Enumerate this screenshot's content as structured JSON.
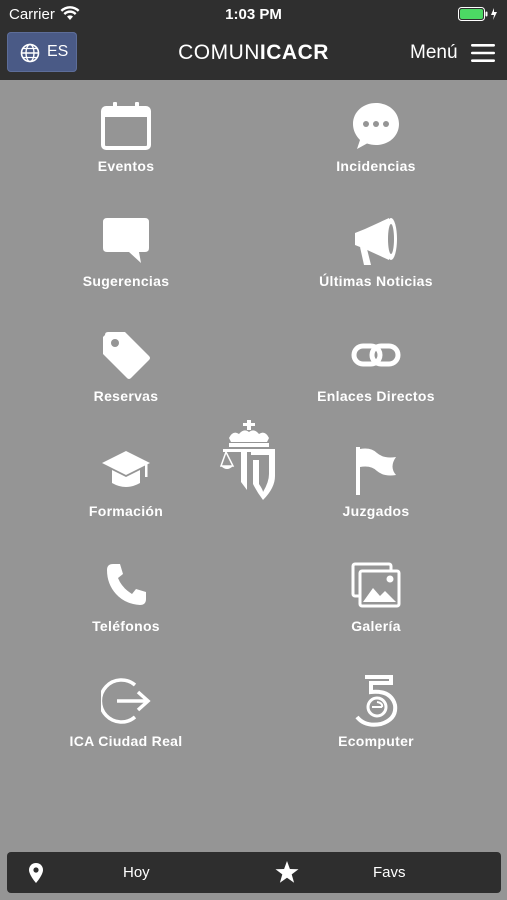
{
  "status_bar": {
    "carrier": "Carrier",
    "time": "1:03 PM"
  },
  "nav": {
    "language": "ES",
    "title_light": "COMUN",
    "title_bold": "ICACR",
    "menu_label": "Menú"
  },
  "tiles": [
    {
      "label": "Eventos",
      "icon": "calendar-icon"
    },
    {
      "label": "Incidencias",
      "icon": "chat-bubble-icon"
    },
    {
      "label": "Sugerencias",
      "icon": "message-icon"
    },
    {
      "label": "Últimas Noticias",
      "icon": "megaphone-icon"
    },
    {
      "label": "Reservas",
      "icon": "tag-icon"
    },
    {
      "label": "Enlaces Directos",
      "icon": "link-icon"
    },
    {
      "label": "Formación",
      "icon": "graduation-cap-icon"
    },
    {
      "label": "Juzgados",
      "icon": "flag-icon"
    },
    {
      "label": "Teléfonos",
      "icon": "phone-icon"
    },
    {
      "label": "Galería",
      "icon": "gallery-icon"
    },
    {
      "label": "ICA Ciudad Real",
      "icon": "exit-arrow-icon"
    },
    {
      "label": "Ecomputer",
      "icon": "ecomputer-logo-icon"
    }
  ],
  "bottom_bar": {
    "today_label": "Hoy",
    "favs_label": "Favs"
  },
  "colors": {
    "background": "#959595",
    "bar": "#2f2f2f",
    "language_button": "#4a5a86",
    "battery": "#4cd964"
  }
}
